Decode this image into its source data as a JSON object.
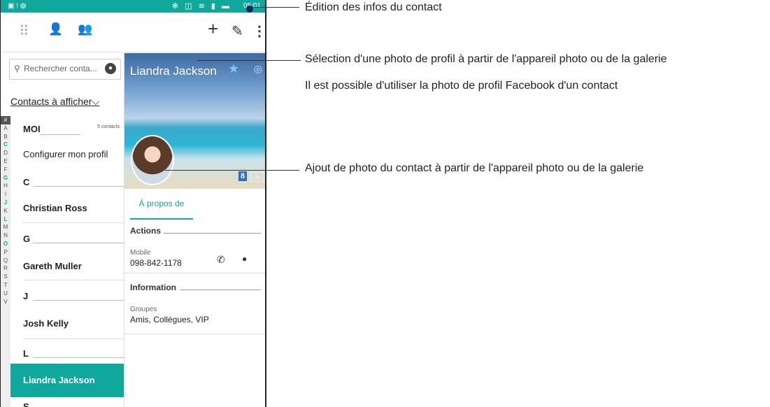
{
  "statusbar": {
    "time": "05:01",
    "left_icons": "▣ ! ◍",
    "right_icons": "✻ ◫ ≋ ▮ ▬"
  },
  "toolbar": {
    "dialpad_icon": "⠿",
    "contacts_icon": "👤",
    "groups_icon": "👥",
    "add_icon": "+",
    "edit_icon": "✎",
    "more_icon": "⋮"
  },
  "search": {
    "placeholder": "Rechercher conta...",
    "search_icon": "⚲",
    "mic_icon": "🎙"
  },
  "filter": {
    "label": "Contacts à afficher",
    "chevron": "⌵"
  },
  "alphabet": [
    "#",
    "A",
    "B",
    "C",
    "D",
    "E",
    "F",
    "G",
    "H",
    "I",
    "J",
    "K",
    "L",
    "M",
    "N",
    "O",
    "P",
    "Q",
    "R",
    "S",
    "T",
    "U",
    "V"
  ],
  "alphabet_highlight": [
    "C",
    "G",
    "J",
    "L",
    "O"
  ],
  "list": {
    "me_header": "MOI",
    "me_count": "5 contacts",
    "setup_profile": "Configurer mon profil",
    "header_c": "C",
    "christian": "Christian Ross",
    "header_g": "G",
    "gareth": "Gareth Muller",
    "header_j": "J",
    "josh": "Josh Kelly",
    "header_l": "L",
    "liandra": "Liandra Jackson",
    "header_next": "S"
  },
  "detail": {
    "name": "Liandra Jackson",
    "star_icon": "★",
    "camera_icon": "◎",
    "google_badge": "8",
    "card_badge": "▤",
    "tab_about": "À propos de",
    "actions_title": "Actions",
    "mobile_label": "Mobile",
    "mobile_number": "098-842-1178",
    "call_icon": "✆",
    "message_icon": "▬",
    "info_title": "Information",
    "groups_label": "Groupes",
    "groups_value": "Amis, Collègues, VIP"
  },
  "callouts": {
    "edit": "Édition des infos du contact",
    "cover_1": "Sélection d'une photo de profil à partir de l'appareil photo ou de la galerie",
    "cover_2": "Il est possible d'utiliser la photo de profil Facebook d'un contact",
    "avatar": "Ajout de photo du contact à partir de l'appareil photo ou de la galerie"
  },
  "colors": {
    "accent": "#10a89c",
    "callout_dot": "#0a2a5a"
  }
}
